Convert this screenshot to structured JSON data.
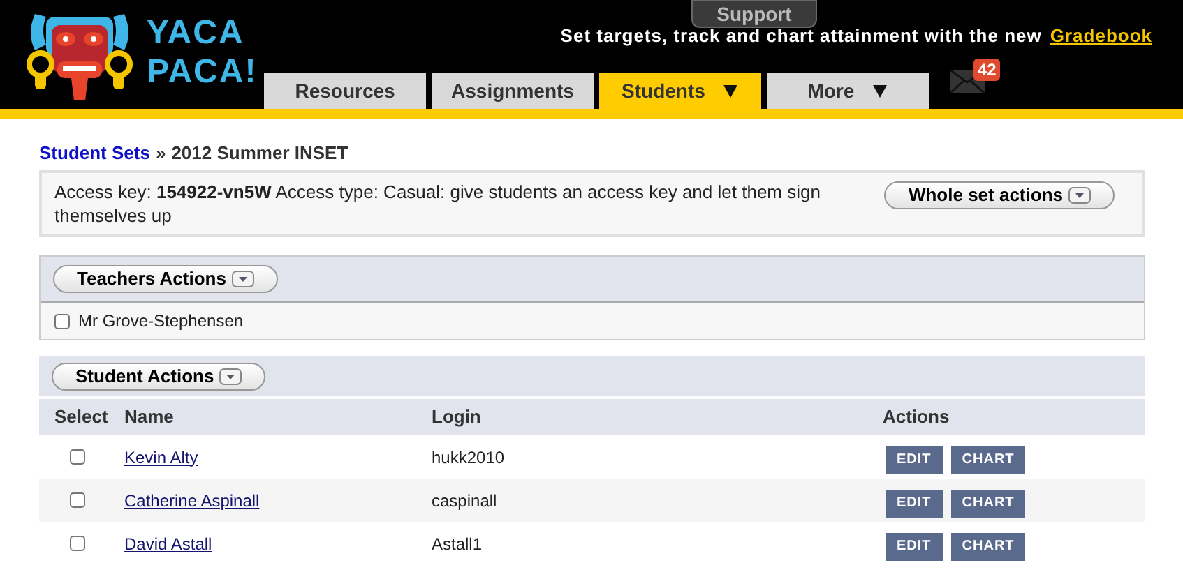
{
  "logo": {
    "line_1": "YACA",
    "line_2": "PACA!"
  },
  "support_tab": "Support",
  "tagline": {
    "text": "Set targets, track and chart attainment with the new",
    "link": "Gradebook"
  },
  "nav_tabs": [
    {
      "label": "Resources",
      "selected": false,
      "dropdown": false
    },
    {
      "label": "Assignments",
      "selected": false,
      "dropdown": false
    },
    {
      "label": "Students",
      "selected": true,
      "dropdown": true
    },
    {
      "label": "More",
      "selected": false,
      "dropdown": true
    }
  ],
  "messages_badge": "42",
  "breadcrumb": {
    "link": "Student Sets",
    "separator": "»",
    "current": "2012 Summer INSET"
  },
  "access_info": "Access key: **154922-vn5W** Access type: Casual: give students an access key and let them sign themselves up",
  "whole_set_button": "Whole set actions",
  "teachers": {
    "actions_button": "Teachers Actions",
    "items": [
      {
        "name": "Mr Grove-Stephensen",
        "checked": false
      }
    ]
  },
  "students": {
    "actions_button": "Student Actions",
    "columns": [
      "Select",
      "Name",
      "Login",
      "Actions"
    ],
    "rows": [
      {
        "name": "Kevin Alty",
        "login": "hukk2010",
        "checked": false,
        "buttons": [
          "EDIT",
          "CHART"
        ]
      },
      {
        "name": "Catherine Aspinall",
        "login": "caspinall",
        "checked": false,
        "buttons": [
          "EDIT",
          "CHART"
        ]
      },
      {
        "name": "David Astall",
        "login": "Astall1",
        "checked": false,
        "buttons": [
          "EDIT",
          "CHART"
        ]
      }
    ]
  }
}
